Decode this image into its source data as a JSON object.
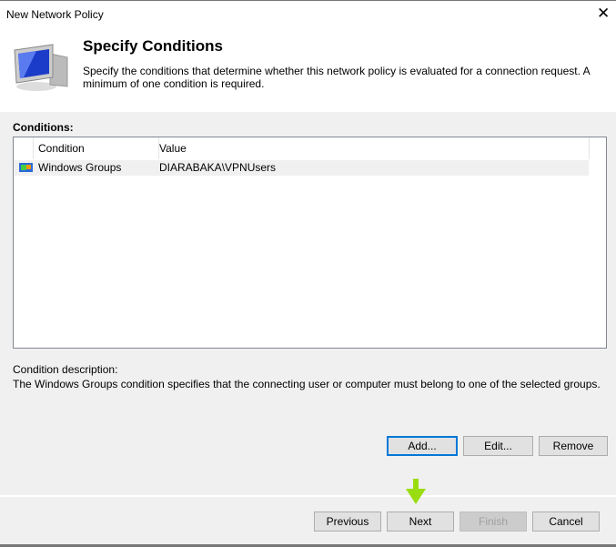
{
  "window": {
    "title": "New Network Policy",
    "close": "✕"
  },
  "header": {
    "title": "Specify Conditions",
    "description": "Specify the conditions that determine whether this network policy is evaluated for a connection request. A minimum of one condition is required."
  },
  "conditions": {
    "label": "Conditions:",
    "columns": [
      "Condition",
      "Value"
    ],
    "rows": [
      {
        "condition": "Windows Groups",
        "value": "DIARABAKA\\VPNUsers"
      }
    ]
  },
  "description": {
    "label": "Condition description:",
    "text": "The Windows Groups condition specifies that the connecting user or computer must belong to one of the selected groups."
  },
  "buttons": {
    "add": "Add...",
    "edit": "Edit...",
    "remove": "Remove",
    "previous": "Previous",
    "next": "Next",
    "finish": "Finish",
    "cancel": "Cancel"
  },
  "colors": {
    "accent": "#0078d7",
    "arrow": "#99dd11"
  }
}
